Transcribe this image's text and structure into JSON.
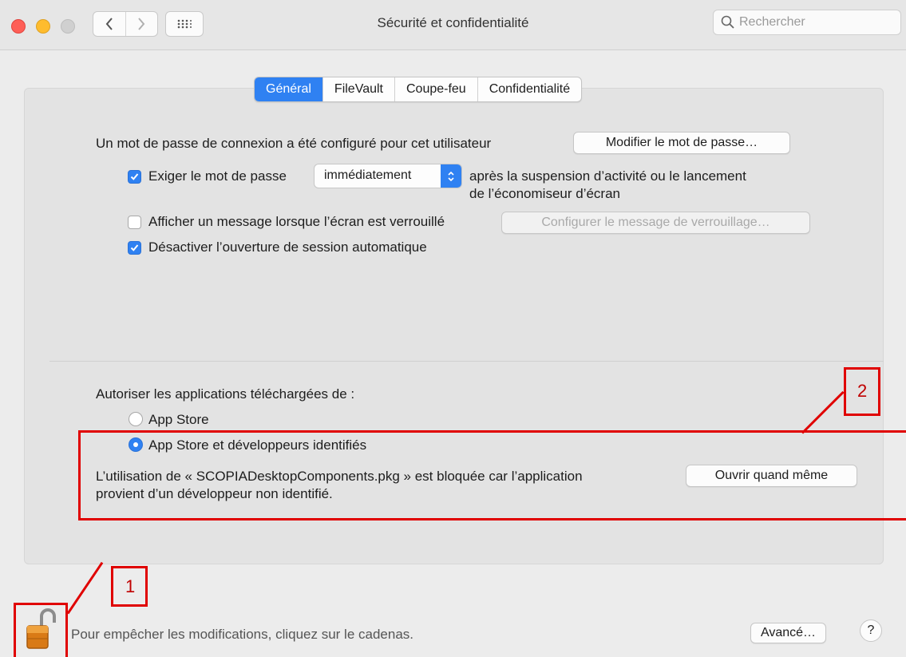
{
  "window": {
    "title": "Sécurité et confidentialité"
  },
  "search": {
    "placeholder": "Rechercher"
  },
  "tabs": [
    {
      "label": "Général",
      "active": true
    },
    {
      "label": "FileVault",
      "active": false
    },
    {
      "label": "Coupe-feu",
      "active": false
    },
    {
      "label": "Confidentialité",
      "active": false
    }
  ],
  "general": {
    "password_text": "Un mot de passe de connexion a été configuré pour cet utilisateur",
    "change_password_button": "Modifier le mot de passe…",
    "require_password_label": "Exiger le mot de passe",
    "require_password_checked": true,
    "require_password_select": "immédiatement",
    "require_password_after_line1": "après la suspension d’activité ou le lancement",
    "require_password_after_line2": "de l’économiseur d’écran",
    "show_message_label": "Afficher un message lorsque l’écran est verrouillé",
    "show_message_checked": false,
    "configure_message_button": "Configurer le message de verrouillage…",
    "disable_autologin_label": "Désactiver l’ouverture de session automatique",
    "disable_autologin_checked": true
  },
  "downloads": {
    "heading": "Autoriser les applications téléchargées de :",
    "option_app_store": "App Store",
    "option_identified": "App Store et développeurs identifiés",
    "selected": "App Store et développeurs identifiés",
    "blocked_line1": "L’utilisation de « SCOPIADesktopComponents.pkg » est bloquée car l’application",
    "blocked_line2": "provient d’un développeur non identifié.",
    "open_anyway_button": "Ouvrir quand même"
  },
  "footer": {
    "lock_text": "Pour empêcher les modifications, cliquez sur le cadenas.",
    "advanced_button": "Avancé…",
    "help_button": "?"
  },
  "annotations": [
    {
      "label": "1"
    },
    {
      "label": "2"
    }
  ],
  "colors": {
    "accent": "#2f81f2",
    "annotation": "#e00000"
  }
}
